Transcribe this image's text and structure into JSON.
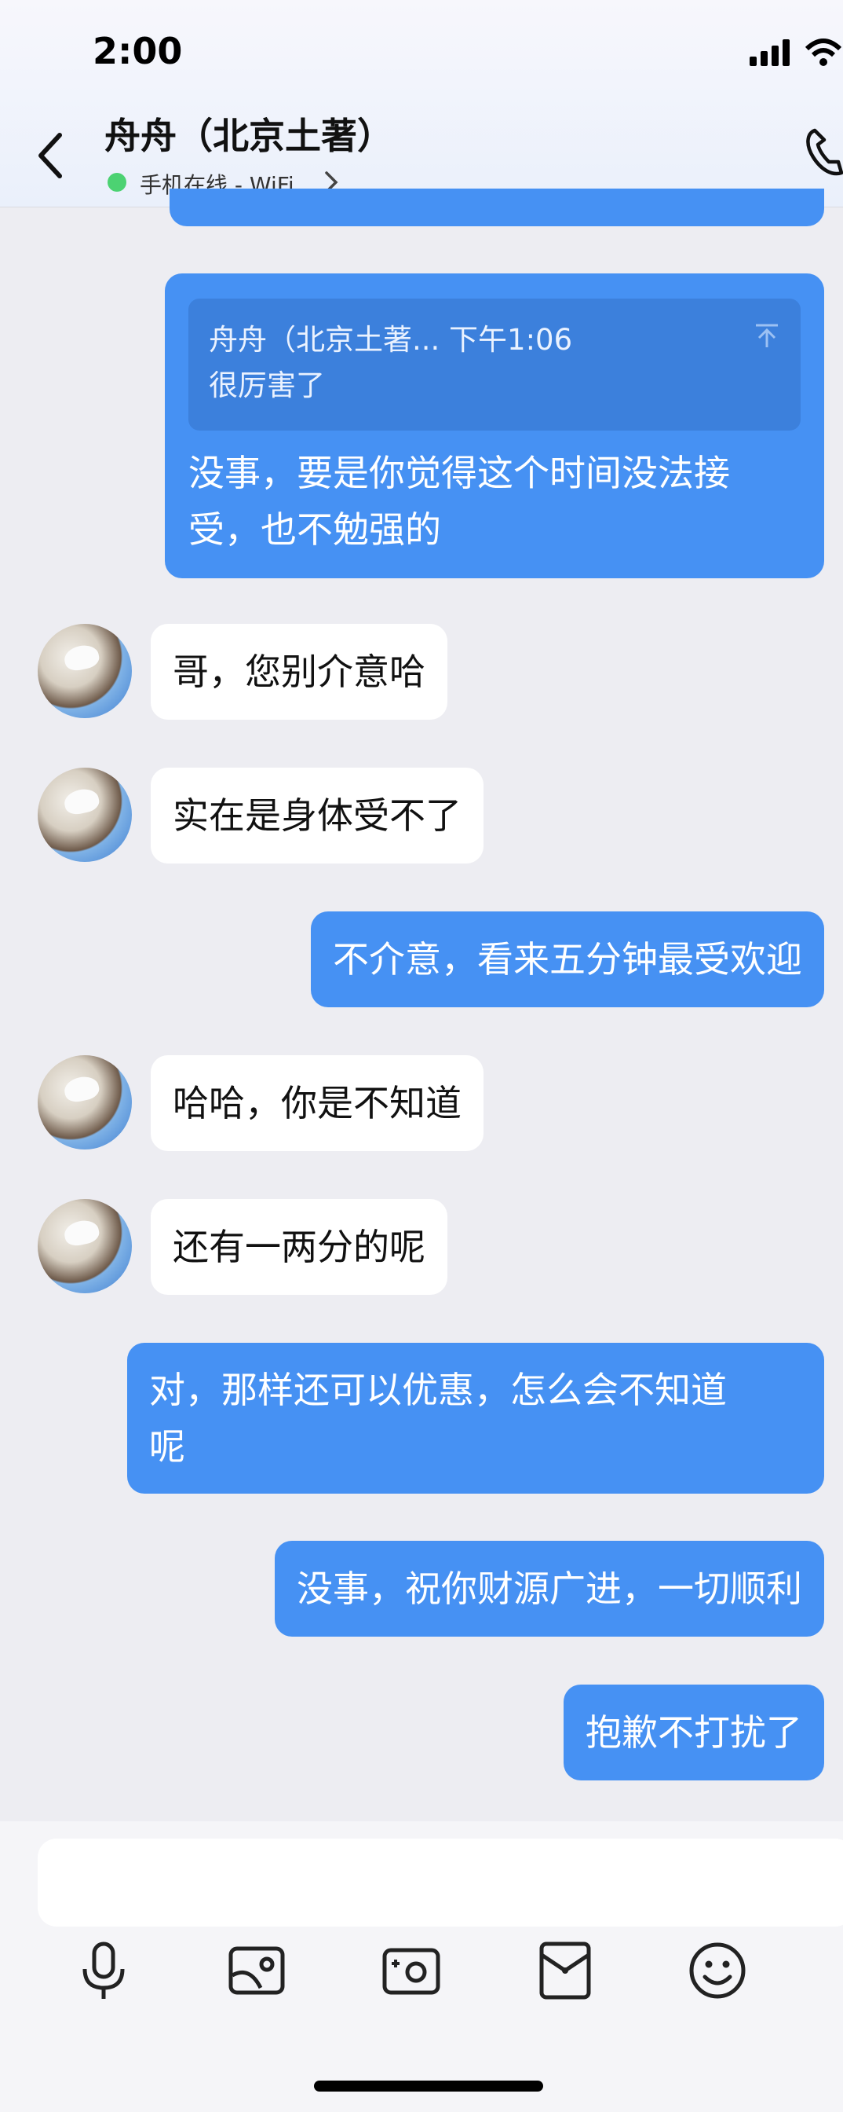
{
  "status_bar": {
    "time": "2:00"
  },
  "header": {
    "title": "舟舟（北京土著）",
    "subtitle": "手机在线 - WiFi",
    "online_color": "#4cd272"
  },
  "colors": {
    "outgoing_bubble": "#4691f3",
    "incoming_bubble": "#ffffff",
    "background": "#ededf2"
  },
  "quote": {
    "header": "舟舟（北京土著... 下午1:06",
    "text": "很厉害了",
    "reply_line1": "没事，要是你觉得这个时间没法接",
    "reply_line2": "受，也不勉强的"
  },
  "messages": [
    {
      "from": "them",
      "text": "哥，您别介意哈"
    },
    {
      "from": "them",
      "text": "实在是身体受不了"
    },
    {
      "from": "me",
      "text": "不介意，看来五分钟最受欢迎"
    },
    {
      "from": "them",
      "text": "哈哈，你是不知道"
    },
    {
      "from": "them",
      "text": "还有一两分的呢"
    },
    {
      "from": "me",
      "text_line1": "对，那样还可以优惠，怎么会不知道",
      "text_line2": "呢"
    },
    {
      "from": "me",
      "text": "没事，祝你财源广进，一切顺利"
    },
    {
      "from": "me",
      "text": "抱歉不打扰了"
    }
  ],
  "toolbar": {
    "icons": [
      "microphone-icon",
      "image-icon",
      "camera-icon",
      "red-packet-icon",
      "emoji-icon"
    ]
  }
}
